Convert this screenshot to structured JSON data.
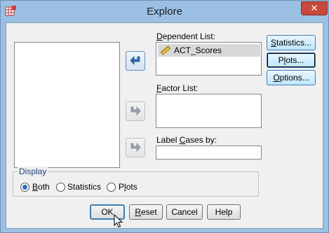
{
  "window": {
    "title": "Explore",
    "close_label": "✕"
  },
  "source_list": {
    "items": []
  },
  "dependent": {
    "label_prefix": "",
    "label_mnemonic": "D",
    "label_rest": "ependent List:",
    "items": [
      "ACT_Scores"
    ]
  },
  "factor": {
    "label_mnemonic": "F",
    "label_rest": "actor List:"
  },
  "label_cases": {
    "label_pre": "Label ",
    "label_mnemonic": "C",
    "label_rest": "ases by:",
    "value": ""
  },
  "side_buttons": {
    "statistics_m": "S",
    "statistics_r": "tatistics...",
    "plots_pre": "P",
    "plots_m": "l",
    "plots_r": "ots...",
    "options_m": "O",
    "options_r": "ptions..."
  },
  "display": {
    "legend": "Display",
    "both_m": "B",
    "both_r": "oth",
    "statistics_label": "Statistics",
    "plots_pre": "P",
    "plots_m": "l",
    "plots_r": "ots",
    "selected": "Both"
  },
  "footer": {
    "ok": "OK",
    "reset_m": "R",
    "reset_r": "eset",
    "cancel": "Cancel",
    "help": "Help"
  },
  "colors": {
    "title_bar": "#9cc0e4",
    "accent": "#2c6bc6",
    "close": "#c7493c"
  }
}
